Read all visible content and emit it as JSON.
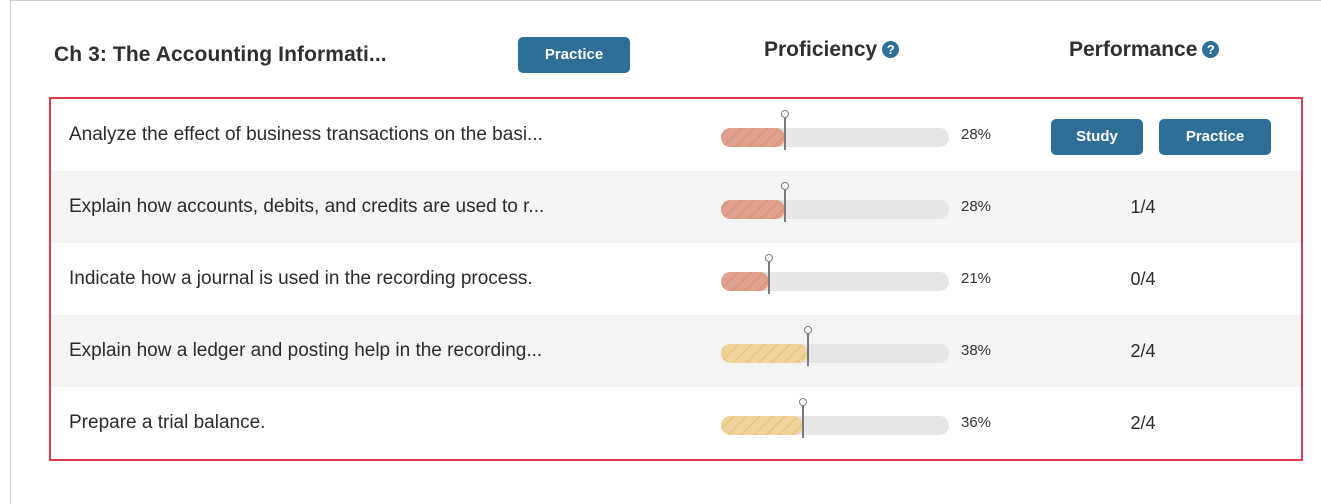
{
  "header": {
    "chapter_title": "Ch 3: The Accounting Informati...",
    "practice_label": "Practice",
    "proficiency_label": "Proficiency",
    "performance_label": "Performance",
    "help_glyph": "?"
  },
  "rows": [
    {
      "label": "Analyze the effect of business transactions on the basi...",
      "proficiency": 0.28,
      "proficiency_text": "28%",
      "level": "low",
      "performance": null,
      "actions": {
        "study_label": "Study",
        "practice_label": "Practice"
      }
    },
    {
      "label": "Explain how accounts, debits, and credits are used to r...",
      "proficiency": 0.28,
      "proficiency_text": "28%",
      "level": "low",
      "performance": "1/4"
    },
    {
      "label": "Indicate how a journal is used in the recording process.",
      "proficiency": 0.21,
      "proficiency_text": "21%",
      "level": "low",
      "performance": "0/4"
    },
    {
      "label": "Explain how a ledger and posting help in the recording...",
      "proficiency": 0.38,
      "proficiency_text": "38%",
      "level": "mid",
      "performance": "2/4"
    },
    {
      "label": "Prepare a trial balance.",
      "proficiency": 0.36,
      "proficiency_text": "36%",
      "level": "mid",
      "performance": "2/4"
    }
  ],
  "colors": {
    "accent": "#2d6f96",
    "highlight_border": "#e0394b",
    "low_fill": "#e0a089",
    "mid_fill": "#efd39a"
  },
  "icons": {
    "help": "question-circle-icon",
    "marker": "proficiency-marker-icon"
  }
}
